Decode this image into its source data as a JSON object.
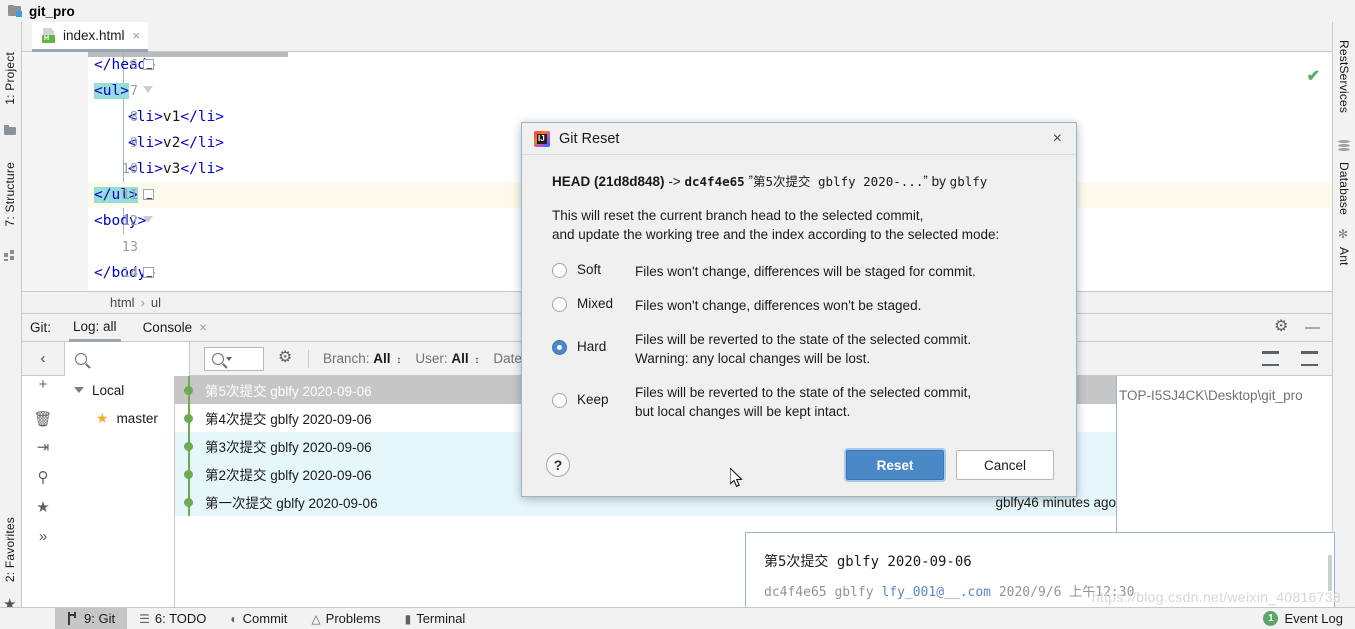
{
  "window": {
    "title": "git_pro",
    "folder_icon": "folder-icon"
  },
  "left_strip": {
    "items": [
      {
        "label": "1: Project",
        "icon": "project-icon"
      },
      {
        "label": "7: Structure",
        "icon": "structure-icon"
      },
      {
        "label": "2: Favorites",
        "icon": "star-icon"
      }
    ]
  },
  "right_strip": {
    "items": [
      {
        "label": "RestServices",
        "icon": "rest-services-icon"
      },
      {
        "label": "Database",
        "icon": "database-icon"
      },
      {
        "label": "Ant",
        "icon": "ant-icon"
      }
    ]
  },
  "editor": {
    "tab": {
      "label": "index.html",
      "icon": "html-file-icon",
      "close": "×"
    },
    "lines": [
      {
        "num": "6",
        "indent": 0,
        "segments": [
          {
            "t": "</head>",
            "c": "tag"
          }
        ]
      },
      {
        "num": "7",
        "indent": 0,
        "segments": [
          {
            "t": "<ul>",
            "c": "tag sel"
          }
        ]
      },
      {
        "num": "8",
        "indent": 2,
        "segments": [
          {
            "t": "<li>",
            "c": "tag"
          },
          {
            "t": "v1",
            "c": "txt"
          },
          {
            "t": "</li>",
            "c": "tag"
          }
        ]
      },
      {
        "num": "9",
        "indent": 2,
        "segments": [
          {
            "t": "<li>",
            "c": "tag"
          },
          {
            "t": "v2",
            "c": "txt"
          },
          {
            "t": "</li>",
            "c": "tag"
          }
        ]
      },
      {
        "num": "10",
        "indent": 2,
        "segments": [
          {
            "t": "<li>",
            "c": "tag"
          },
          {
            "t": "v3",
            "c": "txt"
          },
          {
            "t": "</li>",
            "c": "tag"
          }
        ]
      },
      {
        "num": "11",
        "indent": 0,
        "segments": [
          {
            "t": "</ul>",
            "c": "tag sel"
          }
        ],
        "highlight": true
      },
      {
        "num": "12",
        "indent": 0,
        "segments": [
          {
            "t": "<body>",
            "c": "tag"
          }
        ]
      },
      {
        "num": "13",
        "indent": 0,
        "segments": []
      },
      {
        "num": "14",
        "indent": 0,
        "segments": [
          {
            "t": "</body>",
            "c": "tag"
          }
        ]
      }
    ],
    "inspection_status": "✔"
  },
  "breadcrumb": {
    "parts": [
      "html",
      "ul"
    ],
    "separator": "›"
  },
  "git_panel": {
    "label": "Git:",
    "tabs": [
      {
        "label": "Log: all",
        "active": true
      },
      {
        "label": "Console",
        "active": false,
        "close": "×"
      }
    ],
    "header_actions": [
      {
        "name": "settings-gear-icon"
      },
      {
        "name": "hide-panel-icon",
        "glyph": "—"
      }
    ],
    "toolbar": {
      "collapse_glyph": "‹",
      "search_placeholder": "",
      "filter_placeholder": "",
      "filters": [
        {
          "label": "Branch:",
          "value": "All"
        },
        {
          "label": "User:",
          "value": "All"
        },
        {
          "label": "Date: A",
          "value": ""
        }
      ],
      "right_actions": [
        {
          "name": "expand-all-icon"
        },
        {
          "name": "collapse-all-icon"
        }
      ]
    },
    "branch_tree": {
      "root": "Local",
      "branches": [
        {
          "label": "master",
          "current": true
        }
      ]
    },
    "side_actions": [
      {
        "name": "add-icon",
        "glyph": "+"
      },
      {
        "name": "delete-icon",
        "glyph": "🗑"
      },
      {
        "name": "merge-icon",
        "glyph": "⇥"
      },
      {
        "name": "search-icon",
        "glyph": "⚲"
      },
      {
        "name": "favorite-icon",
        "glyph": "★"
      },
      {
        "name": "more-icon",
        "glyph": "»"
      }
    ],
    "commits": [
      {
        "message": "第5次提交 gblfy 2020-09-06",
        "selected": true,
        "tag": true,
        "author": "",
        "time": ""
      },
      {
        "message": "第4次提交 gblfy 2020-09-06",
        "selected": false,
        "tag": false,
        "author": "",
        "time": ""
      },
      {
        "message": "第3次提交 gblfy 2020-09-06",
        "selected": false,
        "tag": false,
        "author": "",
        "time": "",
        "alt": true
      },
      {
        "message": "第2次提交 gblfy 2020-09-06",
        "selected": false,
        "tag": false,
        "author": "",
        "time": "",
        "alt": true
      },
      {
        "message": "第一次提交 gblfy 2020-09-06",
        "selected": false,
        "tag": false,
        "author": "gblfy",
        "time": "46 minutes ago",
        "alt": true
      }
    ],
    "repo_path": "TOP-I5SJ4CK\\Desktop\\git_pro"
  },
  "commit_detail": {
    "title": "第5次提交 gblfy 2020-09-06",
    "meta_hash": "dc4f4e65",
    "meta_author": "gblfy",
    "meta_email": "lfy_001@__.com",
    "meta_date": "2020/9/6 上午12:30"
  },
  "watermark": "https://blog.csdn.net/weixin_40816738",
  "statusbar": {
    "items": [
      {
        "label": "9: Git",
        "underline": "9",
        "icon": "git-branch-icon",
        "active": true
      },
      {
        "label": "6: TODO",
        "underline": "6",
        "icon": "todo-list-icon",
        "active": false
      },
      {
        "label": "Commit",
        "icon": "commit-icon",
        "active": false
      },
      {
        "label": "Problems",
        "icon": "warning-triangle-icon",
        "active": false
      },
      {
        "label": "Terminal",
        "icon": "terminal-icon",
        "active": false
      }
    ],
    "event_log": {
      "label": "Event Log",
      "count": "1"
    }
  },
  "dialog": {
    "title": "Git Reset",
    "icon": "intellij-idea-icon",
    "close_glyph": "×",
    "head": {
      "head_label": "HEAD (21d8d848)",
      "arrow": "->",
      "target_hash": "dc4f4e65",
      "quote_open": "ˮ",
      "commit_summary": "第5次提交 gblfy 2020-...",
      "quote_close": "ˮ",
      "by": "by",
      "author": "gblfy"
    },
    "description_line1": "This will reset the current branch head to the selected commit,",
    "description_line2": "and update the working tree and the index according to the selected mode:",
    "options": [
      {
        "name": "Soft",
        "selected": false,
        "lines": [
          "Files won't change, differences will be staged for commit."
        ]
      },
      {
        "name": "Mixed",
        "selected": false,
        "lines": [
          "Files won't change, differences won't be staged."
        ]
      },
      {
        "name": "Hard",
        "selected": true,
        "lines": [
          "Files will be reverted to the state of the selected commit.",
          "Warning: any local changes will be lost."
        ]
      },
      {
        "name": "Keep",
        "selected": false,
        "lines": [
          "Files will be reverted to the state of the selected commit,",
          "but local changes will be kept intact."
        ]
      }
    ],
    "help_glyph": "?",
    "buttons": {
      "primary": "Reset",
      "secondary": "Cancel"
    }
  },
  "colors": {
    "accent_blue": "#4a88c7",
    "selection_teal": "#96dcd9",
    "git_green": "#6cab53",
    "row_alt": "#e6f7fb",
    "panel_bg": "#f2f2f2"
  }
}
